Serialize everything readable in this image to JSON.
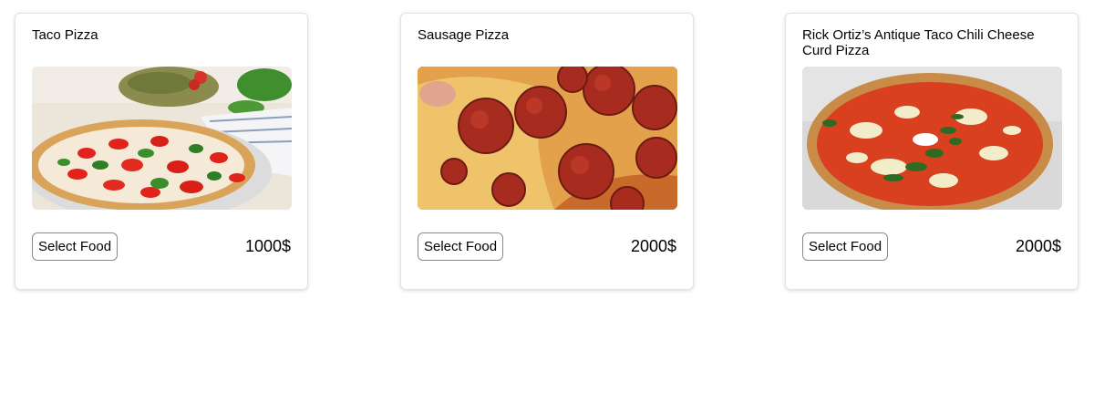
{
  "menu": {
    "items": [
      {
        "name": "Taco Pizza",
        "button_label": "Select Food",
        "price": "1000$",
        "image": "margherita-pizza-photo"
      },
      {
        "name": "Sausage Pizza",
        "button_label": "Select Food",
        "price": "2000$",
        "image": "pepperoni-pizza-photo"
      },
      {
        "name": "Rick Ortiz’s Antique Taco Chili Cheese Curd Pizza",
        "button_label": "Select Food",
        "price": "2000$",
        "image": "neapolitan-pizza-photo"
      }
    ]
  },
  "colors": {
    "card_border": "#e2e2e2",
    "button_border": "#8a8a8a",
    "text": "#000000"
  }
}
